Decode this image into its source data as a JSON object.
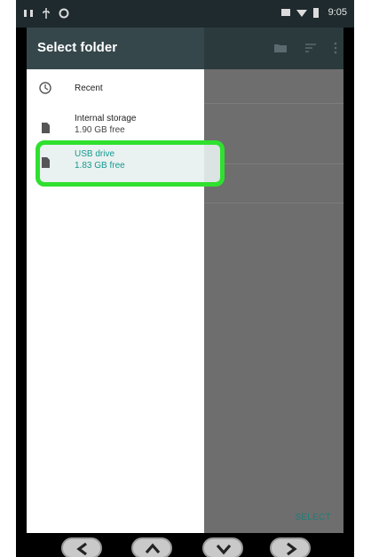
{
  "statusbar": {
    "left_icons": [
      "notification-icon",
      "usb-icon",
      "sync-icon"
    ],
    "right_icons": [
      "sim-icon",
      "wifi-icon",
      "battery-icon"
    ],
    "time": "9:05"
  },
  "drawer": {
    "title": "Select folder",
    "items": [
      {
        "label": "Recent",
        "sub": "",
        "icon": "clock-icon"
      },
      {
        "label": "Internal storage",
        "sub": "1.90 GB free",
        "icon": "sd-card-icon"
      },
      {
        "label": "USB drive",
        "sub": "1.83 GB free",
        "icon": "sd-card-icon",
        "selected": true
      }
    ]
  },
  "toolbar": {
    "icons": [
      "folder-icon",
      "sort-icon",
      "more-vert-icon"
    ]
  },
  "actions": {
    "select_label": "SELECT"
  },
  "navbar": {
    "buttons": [
      "back-icon",
      "up-icon",
      "down-icon",
      "forward-icon"
    ]
  },
  "colors": {
    "header_bg": "#35474b",
    "highlight": "#2fe02f",
    "accent": "#149a8e"
  }
}
